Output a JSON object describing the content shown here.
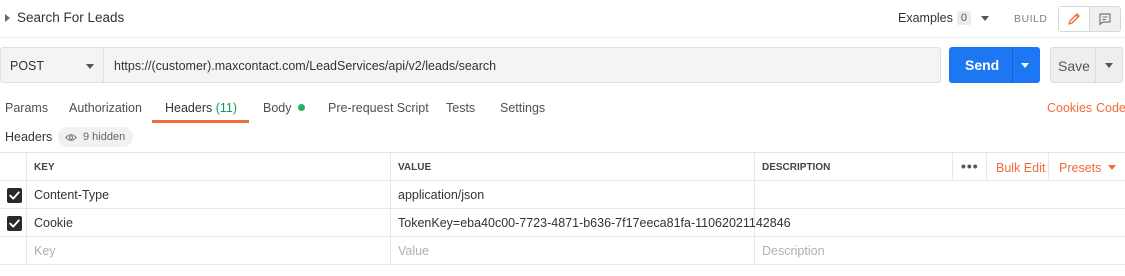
{
  "request": {
    "title": "Search For Leads",
    "examples_label": "Examples",
    "examples_count": "0",
    "build_label": "BUILD"
  },
  "url_bar": {
    "method": "POST",
    "url": "https://(customer).maxcontact.com/LeadServices/api/v2/leads/search",
    "send_label": "Send",
    "save_label": "Save"
  },
  "tabs": [
    {
      "label": "Params"
    },
    {
      "label": "Authorization"
    },
    {
      "label": "Headers",
      "count": "(11)",
      "active": true
    },
    {
      "label": "Body",
      "indicator": "green-dot"
    },
    {
      "label": "Pre-request Script"
    },
    {
      "label": "Tests"
    },
    {
      "label": "Settings"
    }
  ],
  "right_links": {
    "cookies": "Cookies",
    "code": "Code"
  },
  "headers_bar": {
    "label": "Headers",
    "hidden_label": "9 hidden"
  },
  "table": {
    "columns": {
      "key": "KEY",
      "value": "VALUE",
      "description": "DESCRIPTION"
    },
    "actions": {
      "bulk_edit": "Bulk Edit",
      "presets": "Presets"
    },
    "rows": [
      {
        "checked": true,
        "key": "Content-Type",
        "value": "application/json",
        "description": ""
      },
      {
        "checked": true,
        "key": "Cookie",
        "value": "TokenKey=eba40c00-7723-4871-b636-7f17eeca81fa-11062021142846",
        "description": ""
      }
    ],
    "placeholders": {
      "key": "Key",
      "value": "Value",
      "description": "Description"
    }
  },
  "colors": {
    "accent_orange": "#f26b3a",
    "send_blue": "#1e77f2",
    "count_green": "#0f9d58",
    "dot_green": "#24b35c"
  }
}
